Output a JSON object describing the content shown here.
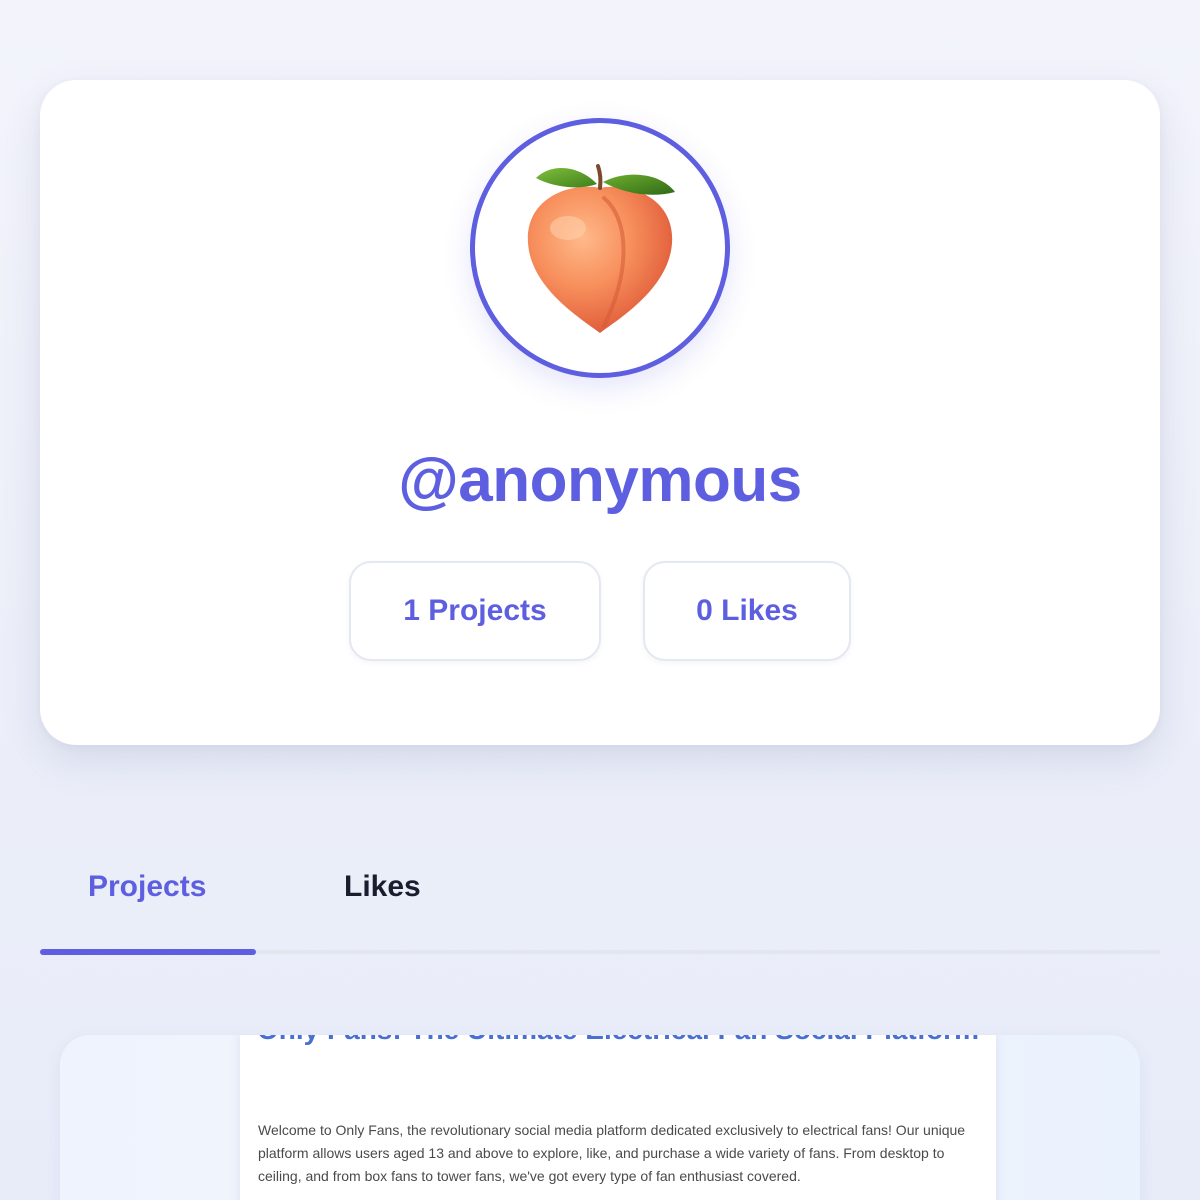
{
  "profile": {
    "avatar_icon": "peach-icon",
    "username": "@anonymous",
    "accent_color": "#5d5fe0",
    "stats": {
      "projects_label": "1 Projects",
      "likes_label": "0 Likes"
    }
  },
  "tabs": {
    "items": [
      {
        "label": "Projects",
        "active": true
      },
      {
        "label": "Likes",
        "active": false
      }
    ]
  },
  "project_preview": {
    "title": "Only Fans: The Ultimate Electrical Fan Social Platform",
    "body": "Welcome to Only Fans, the revolutionary social media platform dedicated exclusively to electrical fans! Our unique platform allows users aged 13 and above to explore, like, and purchase a wide variety of fans. From desktop to ceiling, and from box fans to tower fans, we've got every type of fan enthusiast covered.",
    "title_color": "#4a6fd2"
  }
}
